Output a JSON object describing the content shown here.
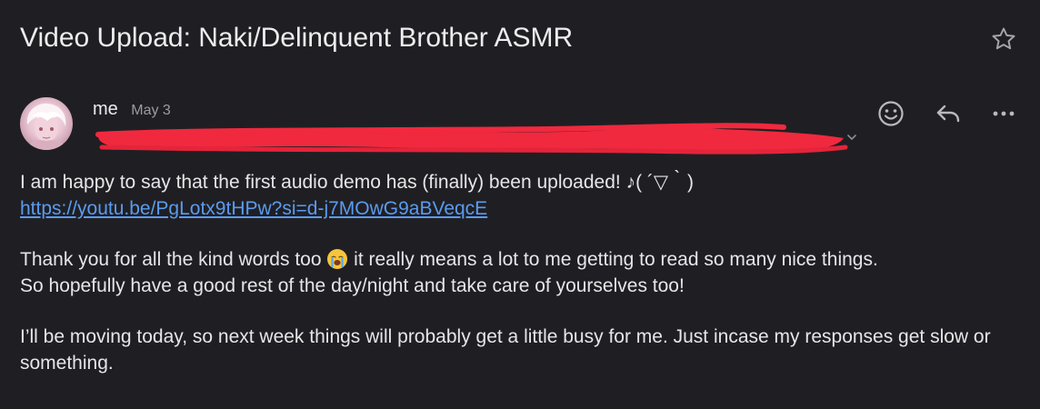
{
  "subject": "Video Upload: Naki/Delinquent Brother ASMR",
  "sender": {
    "name": "me",
    "date": "May 3"
  },
  "icons": {
    "star": "star-icon",
    "react": "emoji-react-icon",
    "reply": "reply-icon",
    "more": "more-options-icon",
    "recipient_toggle": "chevron-down-icon",
    "emoji_in_body": "loudly-crying-face-emoji"
  },
  "colors": {
    "background": "#1f1f23",
    "text": "#e6e6e8",
    "link": "#5b9bf0",
    "redaction": "#f0293e"
  },
  "body": {
    "line1": "I am happy to say that the first audio demo has (finally) been uploaded! ♪( ´▽｀)",
    "link": "https://youtu.be/PgLotx9tHPw?si=d-j7MOwG9aBVeqcE",
    "p2_before_emoji": "Thank you for all the kind words too ",
    "p2_after_emoji": " it really means a lot to me getting to read so many nice things.",
    "p2_line2": "So hopefully have a good rest of the day/night and take care of yourselves too!",
    "p3": "I’ll be moving today, so next week things will probably get a little busy for me. Just incase my responses get slow or something."
  }
}
